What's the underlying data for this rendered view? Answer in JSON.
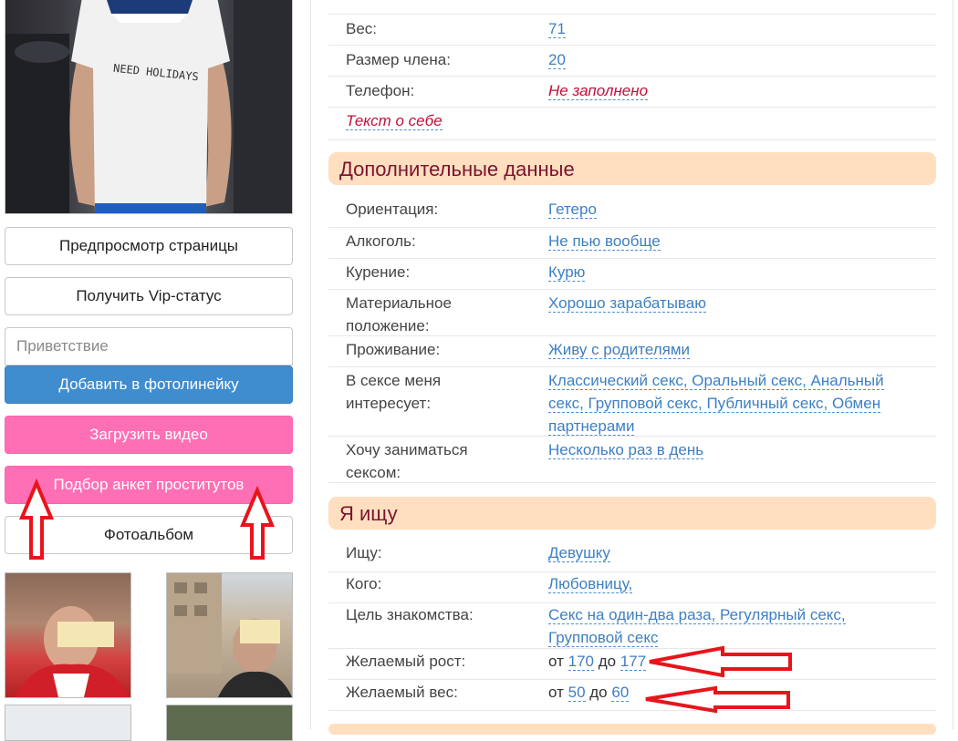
{
  "left": {
    "buttons": {
      "preview": "Предпросмотр страницы",
      "vip": "Получить Vip-статус",
      "add_photoline": "Добавить в фотолинейку",
      "upload_video": "Загрузить видео",
      "escort_search": "Подбор анкет проститутов",
      "album": "Фотоальбом"
    },
    "greeting_placeholder": "Приветствие",
    "tshirt_text": "NEED HOLIDAYS"
  },
  "profile": {
    "ves_label": "Вес:",
    "ves_value": "71",
    "razmer_label": "Размер члена:",
    "razmer_value": "20",
    "phone_label": "Телефон:",
    "phone_value": "Не заполнено",
    "about_link": "Текст о себе"
  },
  "extra": {
    "title": "Дополнительные данные",
    "rows": [
      {
        "label": "Ориентация:",
        "value": "Гетеро"
      },
      {
        "label": "Алкоголь:",
        "value": "Не пью вообще"
      },
      {
        "label": "Курение:",
        "value": "Курю"
      },
      {
        "label": "Материальное положение:",
        "value": "Хорошо зарабатываю"
      },
      {
        "label": "Проживание:",
        "value": "Живу с родителями"
      },
      {
        "label": "В сексе меня интересует:",
        "value": "Классический секс, Оральный секс, Анальный секс, Групповой секс, Публичный секс, Обмен партнерами"
      },
      {
        "label": "Хочу заниматься сексом:",
        "value": "Несколько раз в день"
      }
    ]
  },
  "seeking": {
    "title": "Я ищу",
    "rows": [
      {
        "label": "Ищу:",
        "value": "Девушку"
      },
      {
        "label": "Кого:",
        "value": "Любовницу,"
      },
      {
        "label": "Цель знакомства:",
        "value": "Секс на один-два раза, Регулярный секс, Групповой секс"
      }
    ],
    "height": {
      "label": "Желаемый рост:",
      "from": "от",
      "min": "170",
      "to": "до",
      "max": "177"
    },
    "weight": {
      "label": "Желаемый вес:",
      "from": "от",
      "min": "50",
      "to": "до",
      "max": "60"
    }
  },
  "colors": {
    "accent_link": "#3d7fc3",
    "section_bg": "#ffdfbf",
    "pink": "#ff6fb5",
    "blue": "#3f8ccf",
    "annotation_red": "#e8141b"
  }
}
